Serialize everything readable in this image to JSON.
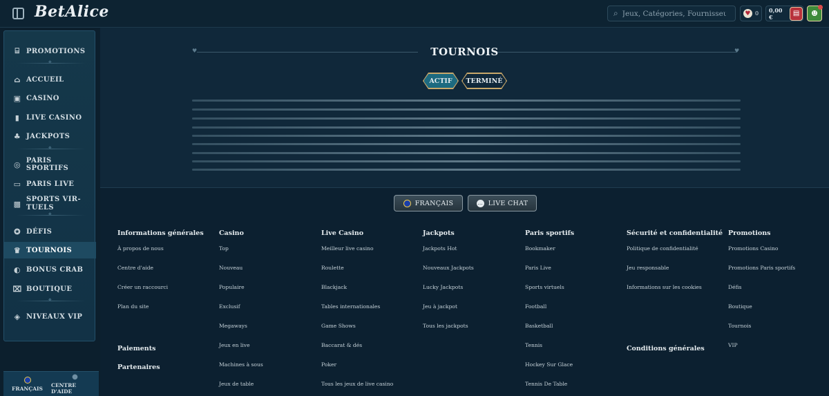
{
  "header": {
    "logo": "BetAlice",
    "search_placeholder": "Jeux, Catégories, Fournisseurs",
    "favorites_count": "0",
    "balance": "0,00 €"
  },
  "sidebar": {
    "items": [
      {
        "label": "PROMOTIONS",
        "icon": "gift-icon"
      },
      {
        "label": "ACCUEIL",
        "icon": "home-icon"
      },
      {
        "label": "CASINO",
        "icon": "slot-machine-icon"
      },
      {
        "label": "LIVE CASINO",
        "icon": "cards-icon"
      },
      {
        "label": "JACKPOTS",
        "icon": "clover-icon"
      },
      {
        "label": "PARIS SPORTIFS",
        "icon": "ball-icon"
      },
      {
        "label": "PARIS LIVE",
        "icon": "live-badge-icon"
      },
      {
        "label": "SPORTS VIR-TUELS",
        "icon": "virtual-sports-icon"
      },
      {
        "label": "DÉFIS",
        "icon": "challenge-icon"
      },
      {
        "label": "TOURNOIS",
        "icon": "trophy-icon"
      },
      {
        "label": "BONUS CRAB",
        "icon": "crab-icon"
      },
      {
        "label": "BOUTIQUE",
        "icon": "shop-icon"
      },
      {
        "label": "NIVEAUX VIP",
        "icon": "diamond-icon"
      }
    ],
    "sports_virtuels_line1": "SPORTS VIR-",
    "sports_virtuels_line2": "TUELS",
    "bottom": {
      "language": "FRANÇAIS",
      "help": "CENTRE D'AIDE"
    }
  },
  "main": {
    "title": "TOURNOIS",
    "tabs": [
      {
        "label": "ACTIF",
        "active": true
      },
      {
        "label": "TERMINÉ",
        "active": false
      }
    ]
  },
  "footer": {
    "language_button": "FRANÇAIS",
    "chat_button": "LIVE CHAT",
    "columns": [
      {
        "title": "Informations générales",
        "links": [
          "À propos de nous",
          "Centre d'aide",
          "Créer un raccourci",
          "Plan du site"
        ],
        "extra": [
          "Paiements",
          "Partenaires"
        ]
      },
      {
        "title": "Casino",
        "links": [
          "Top",
          "Nouveau",
          "Populaire",
          "Exclusif",
          "Megaways",
          "Jeux en live",
          "Machines à sous",
          "Jeux de table"
        ]
      },
      {
        "title": "Live Casino",
        "links": [
          "Meilleur live casino",
          "Roulette",
          "Blackjack",
          "Tables internationales",
          "Game Shows",
          "Baccarat & dés",
          "Poker",
          "Tous les jeux de live casino"
        ]
      },
      {
        "title": "Jackpots",
        "links": [
          "Jackpots Hot",
          "Nouveaux Jackpots",
          "Lucky Jackpots",
          "Jeu à jackpot",
          "Tous les jackpots"
        ]
      },
      {
        "title": "Paris sportifs",
        "links": [
          "Bookmaker",
          "Paris Live",
          "Sports virtuels",
          "Football",
          "Basketball",
          "Tennis",
          "Hockey Sur Glace",
          "Tennis De Table"
        ]
      },
      {
        "title": "Sécurité et confidentialité",
        "links": [
          "Politique de confidentialité",
          "Jeu responsable",
          "Informations sur les cookies"
        ],
        "extra": [
          "Conditions générales"
        ]
      },
      {
        "title": "Promotions",
        "links": [
          "Promotions Casino",
          "Promotions Paris sportifs",
          "Défis",
          "Boutique",
          "Tournois",
          "VIP"
        ]
      }
    ]
  },
  "colors": {
    "background": "#0f2535",
    "sidebar_panel": "#15384a",
    "active_tab": "#1d6a80",
    "gold_accent": "#c9a86a",
    "wallet_red": "#b8323b",
    "user_green": "#3e8b3a"
  }
}
